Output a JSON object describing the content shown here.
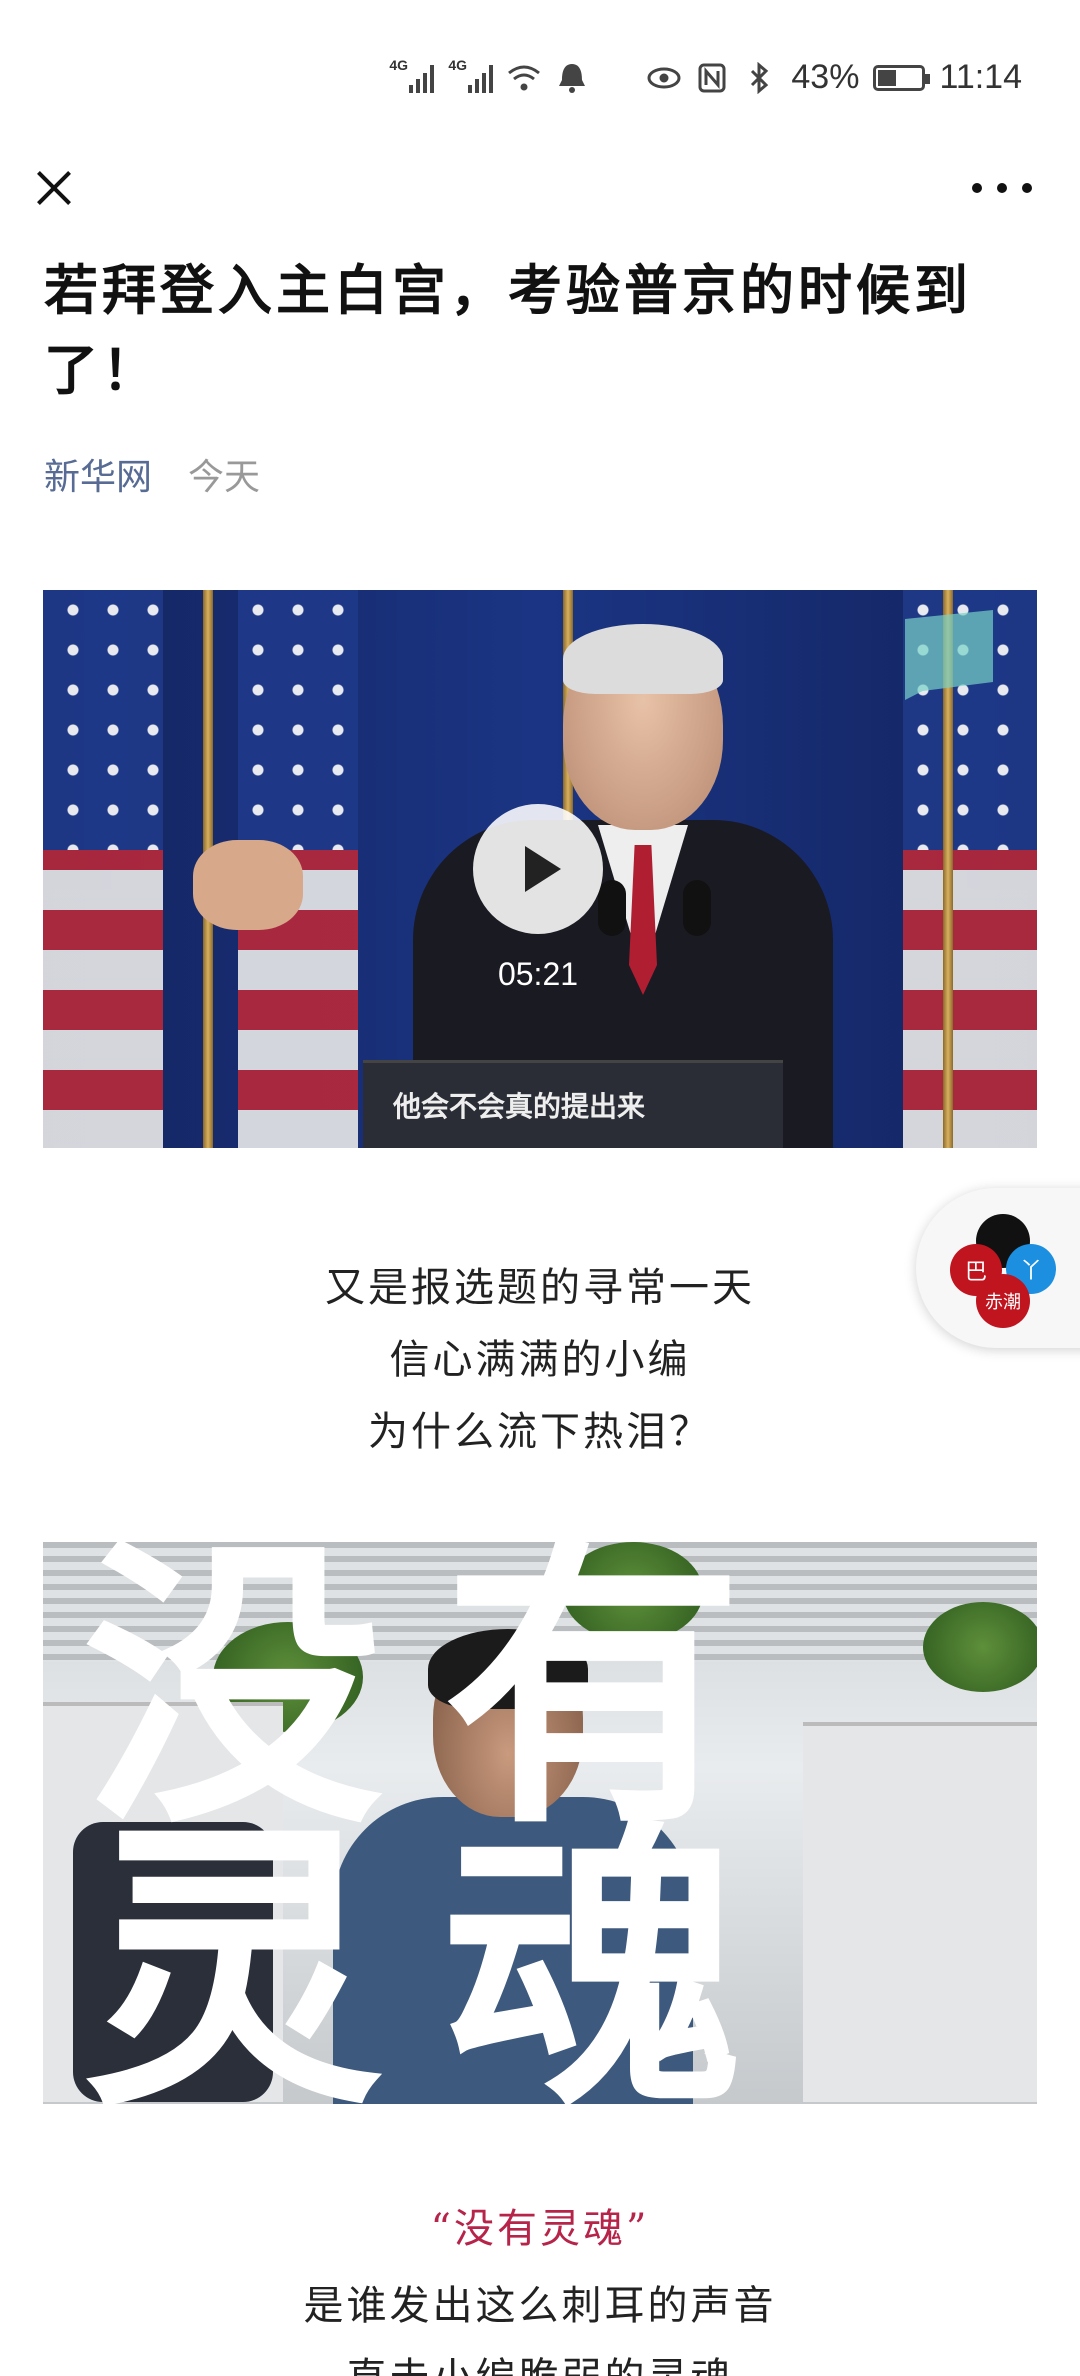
{
  "status_bar": {
    "net1": "4G",
    "net2": "4G",
    "battery_percent": "43%",
    "battery_level": 0.43,
    "time": "11:14",
    "icons": [
      "signal-icon",
      "signal-icon",
      "wifi-icon",
      "notification-bell-icon",
      "eye-icon",
      "nfc-icon",
      "bluetooth-icon",
      "battery-icon"
    ]
  },
  "nav": {
    "close_icon": "close-icon",
    "more_icon": "more-dots-icon"
  },
  "article": {
    "title": "若拜登入主白宫，考验普京的时候到了！",
    "source": "新华网",
    "date": "今天"
  },
  "video": {
    "duration": "05:21",
    "caption": "他会不会真的提出来",
    "play_icon": "play-icon"
  },
  "intro_lines": [
    "又是报选题的寻常一天",
    "信心满满的小编",
    "为什么流下热泪？"
  ],
  "image_overlay": {
    "line1": "没有",
    "line2": "灵魂"
  },
  "quote": {
    "text": "“没有灵魂”",
    "line1": "是谁发出这么刺耳的声音",
    "line2": "直击小编脆弱的灵魂"
  },
  "float_widget": {
    "labels": [
      "巴",
      "赤",
      "丫",
      "赤潮"
    ]
  },
  "colors": {
    "source_link": "#576b95",
    "quote_accent": "#b6244a"
  }
}
